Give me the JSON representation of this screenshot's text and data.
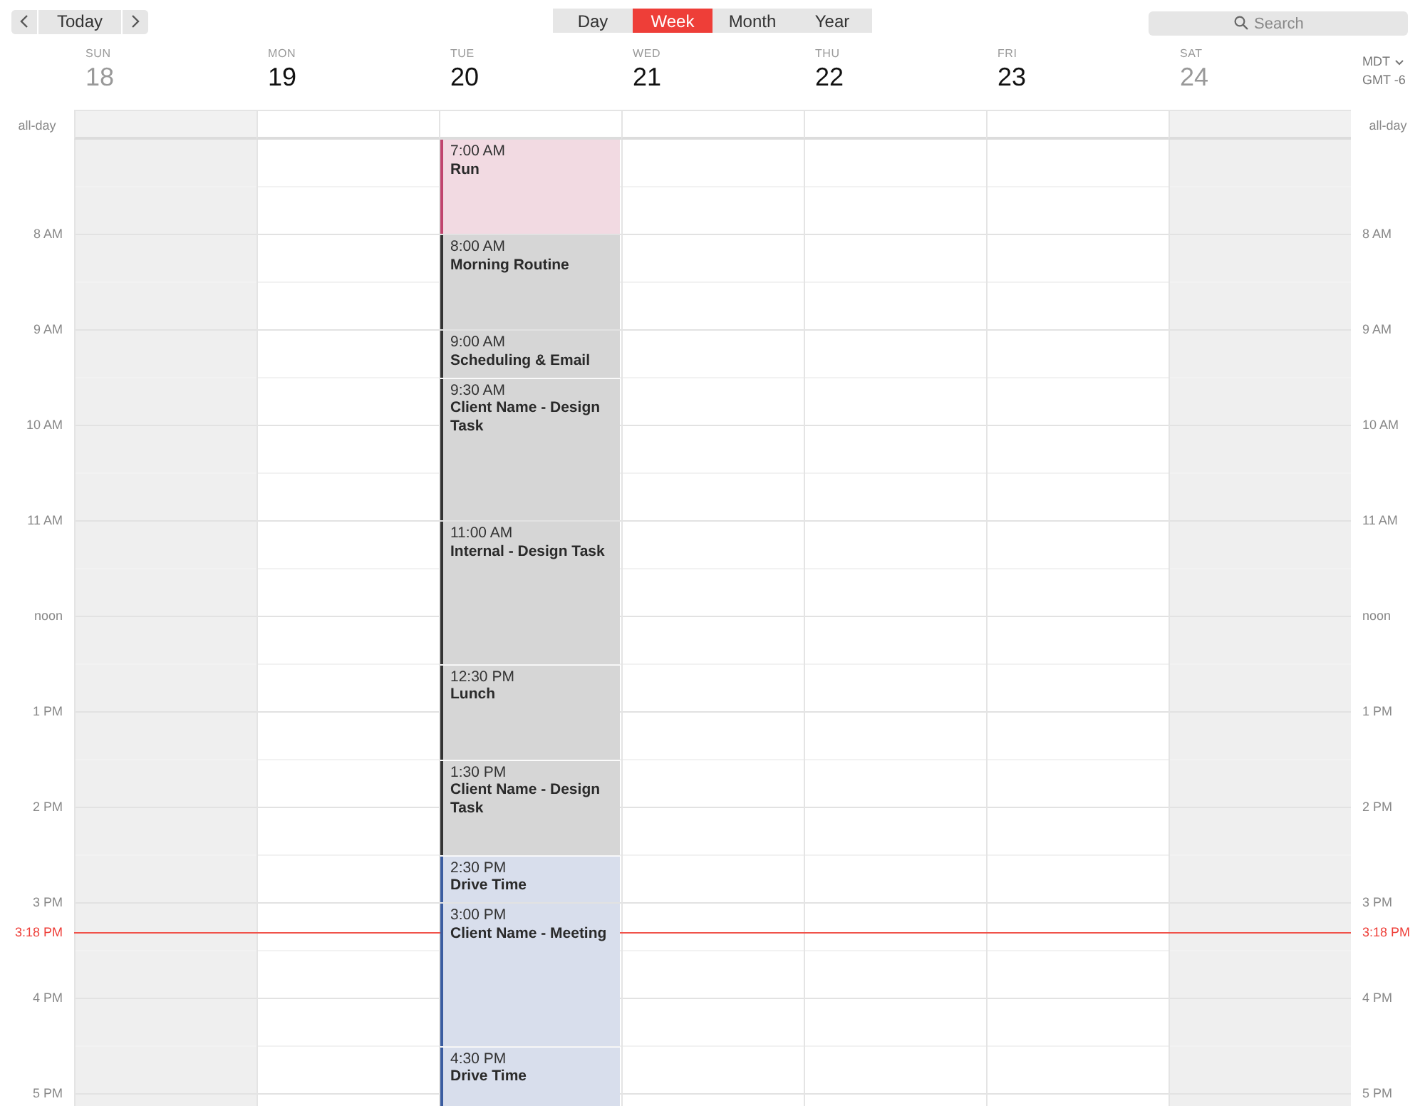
{
  "toolbar": {
    "today_button": "Today",
    "view_tabs": [
      {
        "label": "Day",
        "selected": false
      },
      {
        "label": "Week",
        "selected": true
      },
      {
        "label": "Month",
        "selected": false
      },
      {
        "label": "Year",
        "selected": false
      }
    ],
    "search": {
      "placeholder": "Search"
    }
  },
  "timezone": {
    "name": "MDT",
    "offset": "GMT -6"
  },
  "days": [
    {
      "name": "SUN",
      "date": "18",
      "weekend": true
    },
    {
      "name": "MON",
      "date": "19",
      "weekend": false
    },
    {
      "name": "TUE",
      "date": "20",
      "weekend": false,
      "events": [
        {
          "time": "7:00 AM",
          "title": "Run",
          "color": "#c0446e"
        },
        {
          "time": "8:00 AM",
          "title": "Morning Routine",
          "color": "#333333"
        },
        {
          "time": "9:00 AM",
          "title": "Scheduling & Email",
          "color": "#333333"
        },
        {
          "time": "9:30 AM",
          "title": "Client Name - Design Task",
          "color": "#333333"
        },
        {
          "time": "11:00 AM",
          "title": "Internal - Design Task",
          "color": "#333333"
        },
        {
          "time": "12:30 PM",
          "title": "Lunch",
          "color": "#333333"
        },
        {
          "time": "1:30 PM",
          "title": "Client Name - Design Task",
          "color": "#333333"
        },
        {
          "time": "2:30 PM",
          "title": "Drive Time",
          "color": "#3a5ca0"
        },
        {
          "time": "3:00 PM",
          "title": "Client Name - Meeting",
          "color": "#3a5ca0"
        },
        {
          "time": "4:30 PM",
          "title": "Drive Time",
          "color": "#3a5ca0"
        }
      ]
    },
    {
      "name": "WED",
      "date": "21",
      "weekend": false
    },
    {
      "name": "THU",
      "date": "22",
      "weekend": false
    },
    {
      "name": "FRI",
      "date": "23",
      "weekend": false
    },
    {
      "name": "SAT",
      "date": "24",
      "weekend": true
    }
  ],
  "all_day_labels": [
    "all-day",
    "all-day"
  ],
  "hour_labels_left": [
    "8 AM",
    "9 AM",
    "10 AM",
    "11 AM",
    "noon",
    "1 PM",
    "2 PM",
    "3 PM",
    "4 PM",
    "5 PM"
  ],
  "hour_labels_right": [
    "8 AM",
    "9 AM",
    "10 AM",
    "11 AM",
    "noon",
    "1 PM",
    "2 PM",
    "3 PM",
    "4 PM",
    "5 PM"
  ],
  "current_time": {
    "left_label": "3:18 PM",
    "right_label": "3:18 PM"
  }
}
